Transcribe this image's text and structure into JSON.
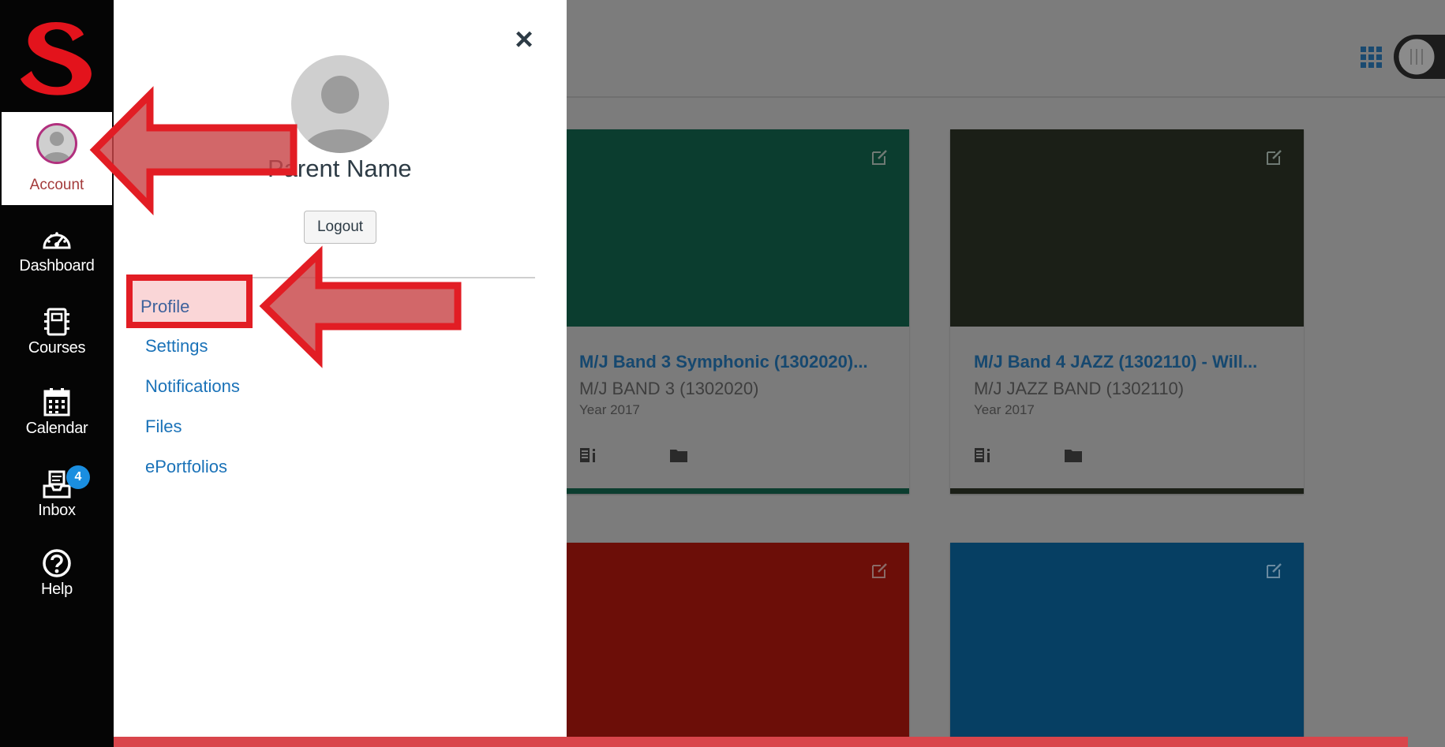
{
  "nav": {
    "account_label": "Account",
    "items": [
      {
        "label": "Dashboard",
        "icon": "dashboard-icon"
      },
      {
        "label": "Courses",
        "icon": "courses-icon"
      },
      {
        "label": "Calendar",
        "icon": "calendar-icon"
      },
      {
        "label": "Inbox",
        "icon": "inbox-icon",
        "badge": "4"
      },
      {
        "label": "Help",
        "icon": "help-icon"
      }
    ]
  },
  "tray": {
    "user_name": "Parent Name",
    "logout_label": "Logout",
    "close_glyph": "×",
    "links": [
      {
        "label": "Profile"
      },
      {
        "label": "Settings"
      },
      {
        "label": "Notifications"
      },
      {
        "label": "Files"
      },
      {
        "label": "ePortfolios"
      }
    ]
  },
  "dashboard": {
    "cards": [
      {
        "title": "M/J Band 3 Symphonic (1302020)...",
        "subtitle": "M/J BAND 3 (1302020)",
        "term": "Year 2017",
        "color": "#0b3d2f"
      },
      {
        "title": "M/J Band 4 JAZZ (1302110) - Will...",
        "subtitle": "M/J JAZZ BAND (1302110)",
        "term": "Year 2017",
        "color": "#1b1f17"
      },
      {
        "title": "",
        "subtitle": "",
        "term": "",
        "color": "#6c0e08"
      },
      {
        "title": "",
        "subtitle": "",
        "term": "",
        "color": "#063f63"
      }
    ]
  },
  "colors": {
    "nav_bg": "#050505",
    "tray_link": "#1a72b8",
    "annotation_red": "#e21d24",
    "overlay": "#7c7c7c"
  }
}
